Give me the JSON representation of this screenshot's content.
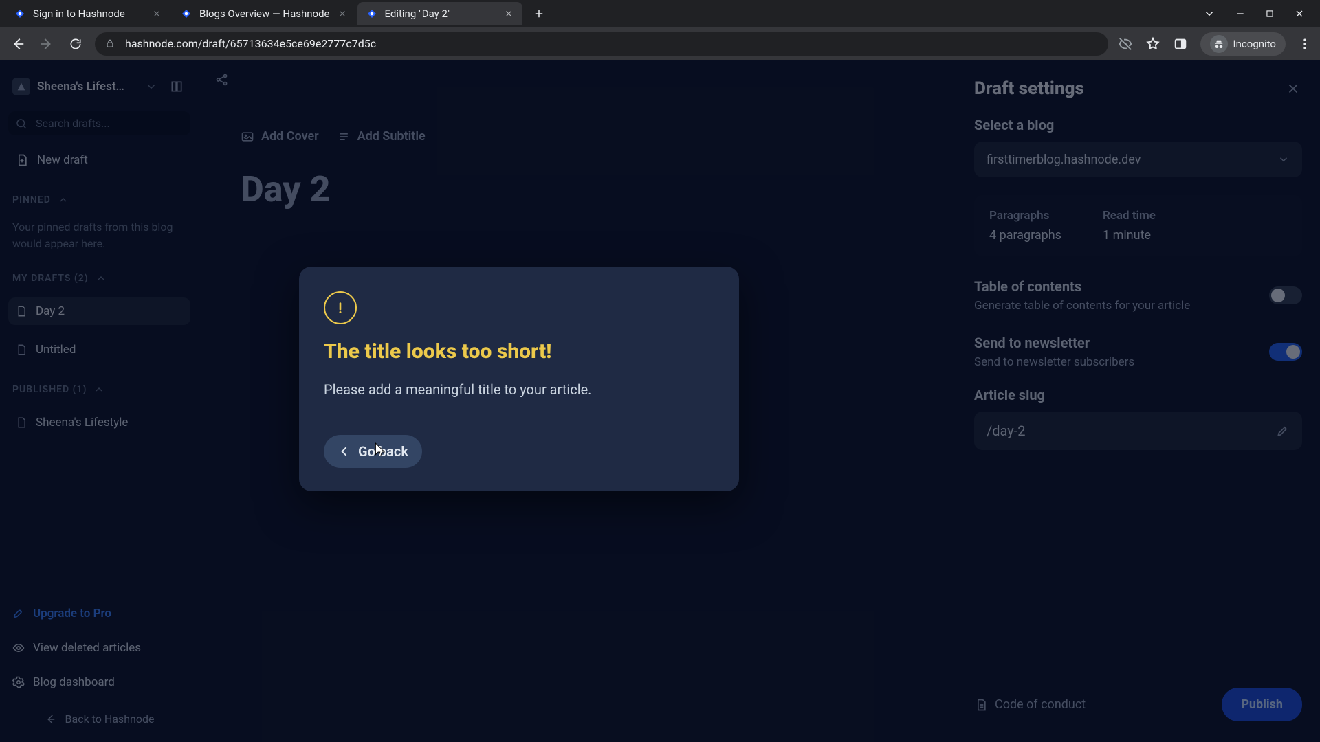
{
  "browser": {
    "tabs": [
      {
        "title": "Sign in to Hashnode"
      },
      {
        "title": "Blogs Overview — Hashnode"
      },
      {
        "title": "Editing \"Day 2\""
      }
    ],
    "url": "hashnode.com/draft/65713634e5ce69e2777c7d5c",
    "incognito_label": "Incognito"
  },
  "sidebar": {
    "blog_name": "Sheena's Lifest…",
    "search_placeholder": "Search drafts...",
    "new_draft_label": "New draft",
    "pinned_header": "PINNED",
    "pinned_hint": "Your pinned drafts from this blog would appear here.",
    "my_drafts_header": "MY DRAFTS (2)",
    "drafts": [
      {
        "title": "Day 2"
      },
      {
        "title": "Untitled"
      }
    ],
    "published_header": "PUBLISHED (1)",
    "published": [
      {
        "title": "Sheena's Lifestyle"
      }
    ],
    "upgrade_label": "Upgrade to Pro",
    "deleted_label": "View deleted articles",
    "dashboard_label": "Blog dashboard",
    "back_label": "Back to Hashnode"
  },
  "editor": {
    "add_cover": "Add Cover",
    "add_subtitle": "Add Subtitle",
    "title": "Day 2"
  },
  "rightpanel": {
    "title": "Draft settings",
    "select_blog_label": "Select a blog",
    "selected_blog": "firsttimerblog.hashnode.dev",
    "stats": {
      "paragraphs_label": "Paragraphs",
      "paragraphs_value": "4 paragraphs",
      "read_label": "Read time",
      "read_value": "1 minute"
    },
    "toc_title": "Table of contents",
    "toc_sub": "Generate table of contents for your article",
    "newsletter_title": "Send to newsletter",
    "newsletter_sub": "Send to newsletter subscribers",
    "slug_label": "Article slug",
    "slug_value": "/day-2",
    "coc_label": "Code of conduct",
    "publish_label": "Publish"
  },
  "modal": {
    "title": "The title looks too short!",
    "body": "Please add a meaningful title to your article.",
    "goback_label": "Go back"
  }
}
